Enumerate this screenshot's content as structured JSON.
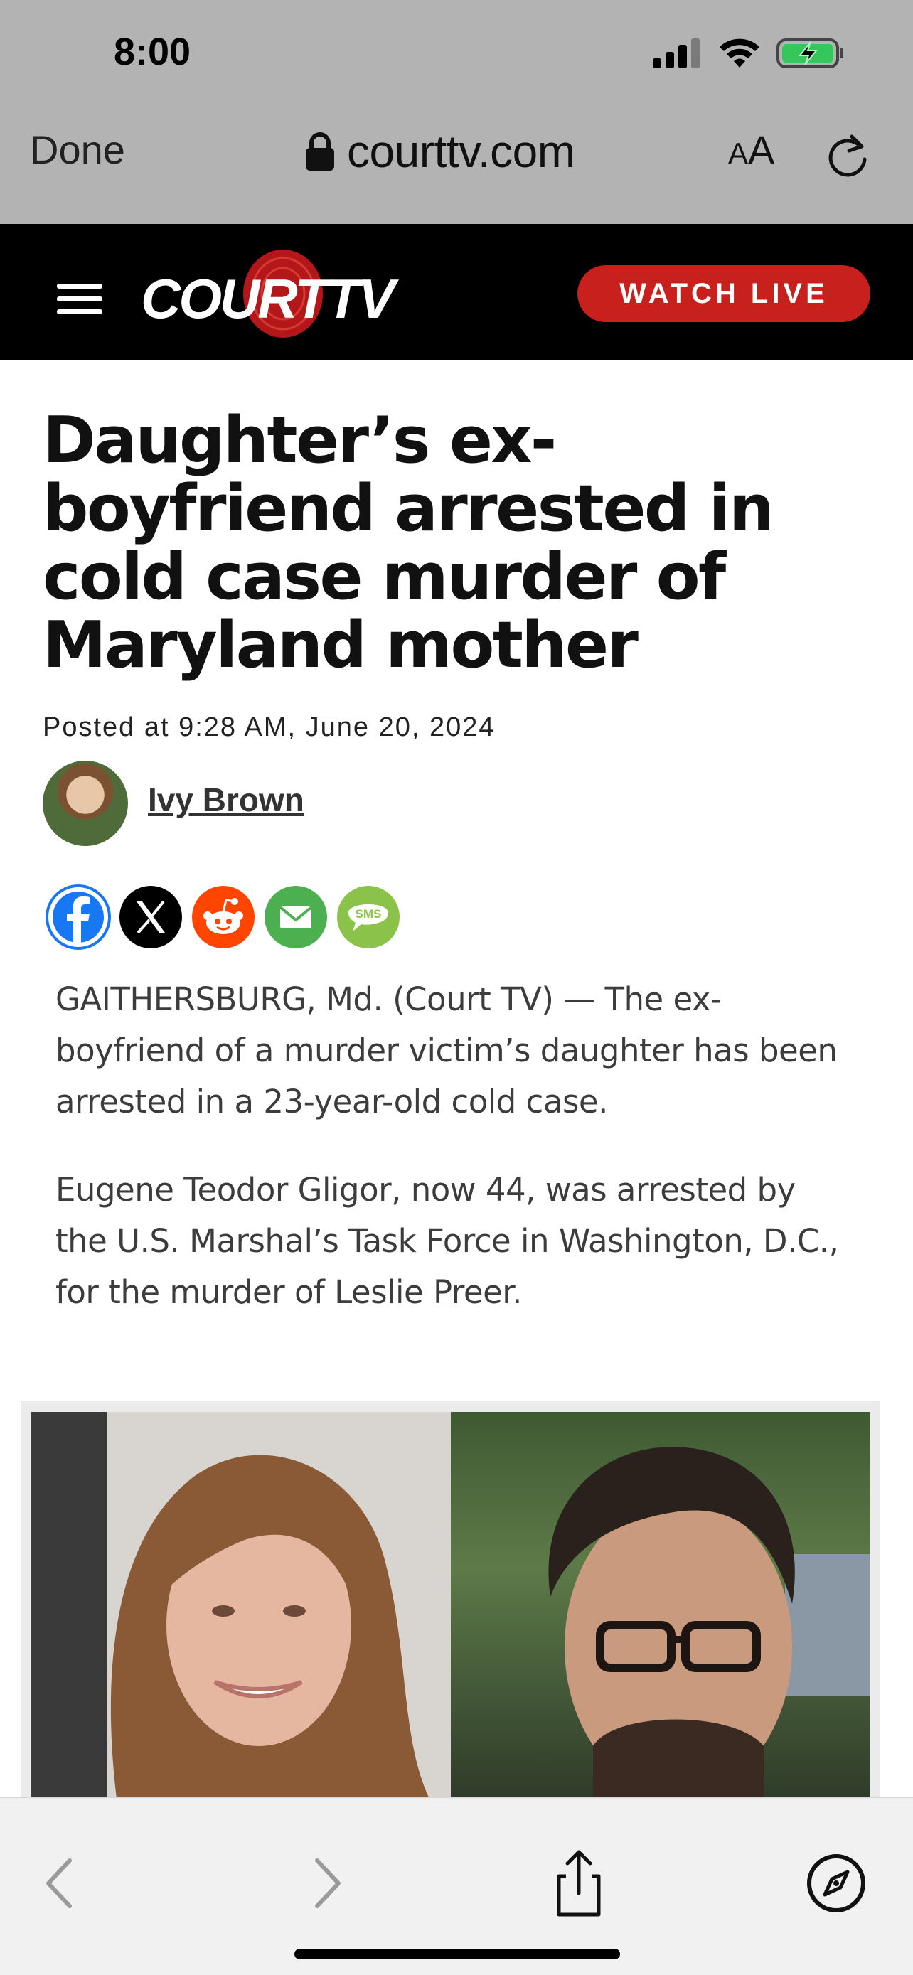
{
  "status_bar": {
    "time": "8:00",
    "icons": [
      "cellular-signal-icon",
      "wifi-icon",
      "battery-charging-icon"
    ]
  },
  "browser": {
    "done_label": "Done",
    "url": "courttv.com",
    "text_size_label_small": "A",
    "text_size_label_large": "A",
    "icons": [
      "lock-icon",
      "reload-icon"
    ]
  },
  "site_header": {
    "logo_text": "COURT",
    "logo_tv": "TV",
    "watch_live_label": "WATCH LIVE",
    "colors": {
      "background": "#000000",
      "accent": "#c8201d"
    }
  },
  "article": {
    "headline": "Daughter’s ex-boyfriend arrested in cold case murder of Maryland mother",
    "posted": "Posted at 9:28 AM, June 20, 2024",
    "author": "Ivy Brown",
    "share_buttons": [
      {
        "name": "facebook",
        "color": "#1877f2"
      },
      {
        "name": "x",
        "color": "#000000"
      },
      {
        "name": "reddit",
        "color": "#ff4500"
      },
      {
        "name": "email",
        "color": "#4caf50"
      },
      {
        "name": "sms",
        "label": "SMS",
        "color": "#8bc34a"
      }
    ],
    "paragraphs": [
      "GAITHERSBURG, Md. (Court TV) — The ex-boyfriend of a murder victim’s daughter has been arrested in a 23-year-old cold case.",
      "Eugene Teodor Gligor, now 44, was arrested by the U.S. Marshal’s Task Force in Washington, D.C., for the murder of Leslie Preer."
    ]
  },
  "toolbar": {
    "icons": [
      "back-icon",
      "forward-icon",
      "share-icon",
      "compass-icon"
    ]
  }
}
